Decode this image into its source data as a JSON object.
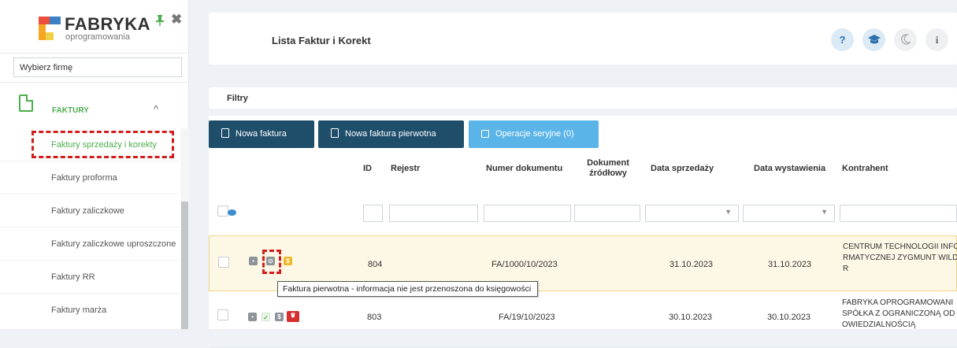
{
  "logo": {
    "title": "FABRYKA",
    "subtitle": "oprogramowania"
  },
  "company_select": {
    "value": "Wybierz firmę"
  },
  "menu": {
    "section_label": "FAKTURY",
    "items": [
      {
        "label": "Faktury sprzedaży i korekty",
        "active": true
      },
      {
        "label": "Faktury proforma"
      },
      {
        "label": "Faktury zaliczkowe"
      },
      {
        "label": "Faktury zaliczkowe uproszczone"
      },
      {
        "label": "Faktury RR"
      },
      {
        "label": "Faktury marża"
      }
    ]
  },
  "header": {
    "title": "Lista Faktur i Korekt",
    "help_label": "?",
    "info_label": "i"
  },
  "filters": {
    "label": "Filtry"
  },
  "toolbar": {
    "new_invoice": "Nowa faktura",
    "new_original_invoice": "Nowa faktura pierwotna",
    "batch_operations": "Operacje seryjne (0)"
  },
  "table": {
    "columns": {
      "id": "ID",
      "register": "Rejestr",
      "doc_number": "Numer dokumentu",
      "source_doc": "Dokument źródłowy",
      "sale_date": "Data sprzedaży",
      "issue_date": "Data wystawienia",
      "contractor": "Kontrahent"
    },
    "rows": [
      {
        "id": "804",
        "doc_number": "FA/1000/10/2023",
        "sale_date": "31.10.2023",
        "issue_date": "31.10.2023",
        "contractor_l1": "CENTRUM TECHNOLOGII INFO",
        "contractor_l2": "RMATYCZNEJ ZYGMUNT WILD",
        "contractor_l3": "R"
      },
      {
        "id": "803",
        "doc_number": "FA/19/10/2023",
        "sale_date": "30.10.2023",
        "issue_date": "30.10.2023",
        "contractor_l1": "FABRYKA OPROGRAMOWANI",
        "contractor_l2": "SPÓŁKA Z OGRANICZONĄ OD",
        "contractor_l3": "OWIEDZIALNOŚCIĄ"
      }
    ]
  },
  "tooltip": {
    "text": "Faktura pierwotna - informacja nie jest przenoszona do księgowości"
  },
  "colors": {
    "brand_green": "#4cae4c",
    "dark_navy": "#1f4e6b",
    "light_blue": "#5bb4e8",
    "highlight_red": "#d31d1d"
  },
  "icons": {
    "pin": "pin-icon",
    "close": "close-icon",
    "document": "document-icon",
    "eye": "eye-icon",
    "help": "question-icon",
    "graduation": "graduation-cap-icon",
    "moon": "moon-icon",
    "info": "info-icon"
  }
}
